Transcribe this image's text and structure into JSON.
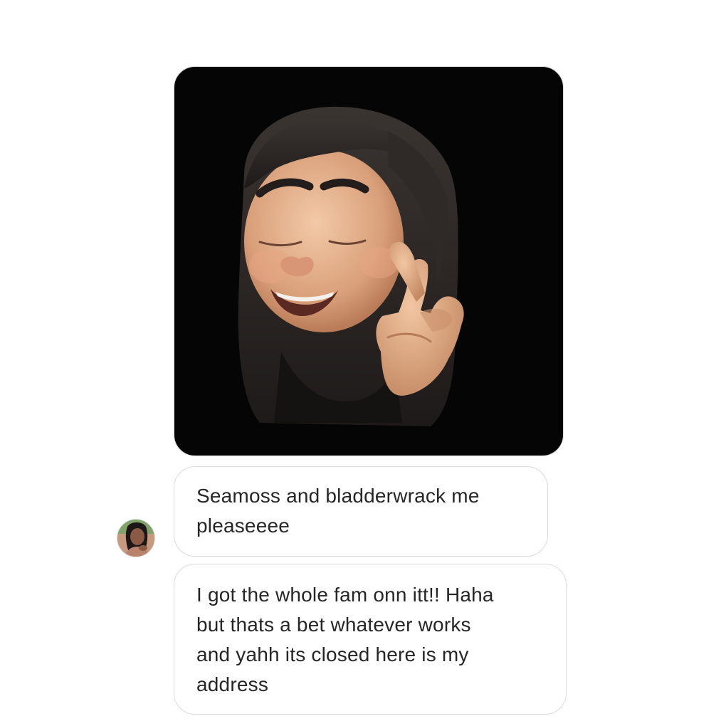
{
  "conversation": {
    "media_message": {
      "type": "memoji-sticker",
      "description_icon": "memoji-fingers-crossed-icon"
    },
    "messages": [
      {
        "lines": [
          "Seamoss and bladderwrack me",
          "pleaseeee"
        ]
      },
      {
        "lines": [
          "I got the whole fam onn itt!! Haha",
          "but thats a bet whatever works",
          "and yahh its closed here is my",
          "address"
        ]
      }
    ],
    "sender_avatar_icon": "profile-photo-avatar"
  },
  "colors": {
    "bubble_border": "#dbdbdb",
    "text": "#262626",
    "sticker_bg": "#050505"
  }
}
